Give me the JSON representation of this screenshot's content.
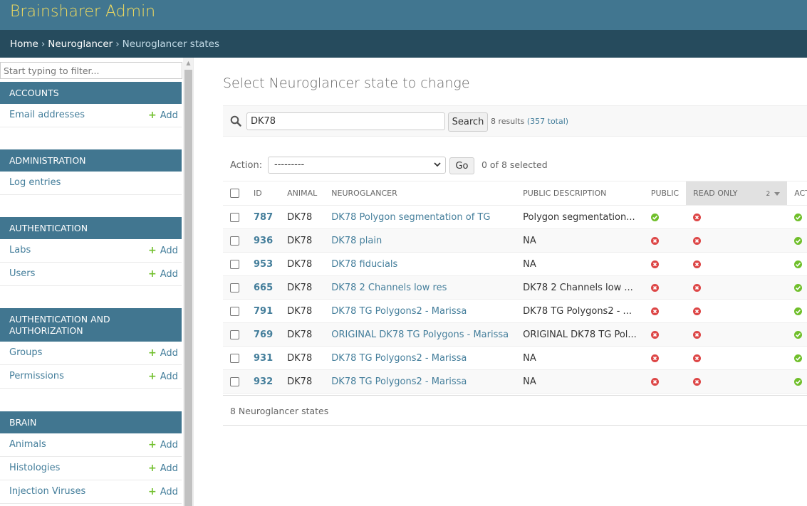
{
  "header": {
    "site_name": "Brainsharer Admin"
  },
  "breadcrumbs": {
    "home": "Home",
    "sep": "›",
    "app": "Neuroglancer",
    "current": "Neuroglancer states"
  },
  "sidebar": {
    "filter_placeholder": "Start typing to filter...",
    "add_label": "Add",
    "apps": [
      {
        "name": "ACCOUNTS",
        "models": [
          {
            "name": "Email addresses",
            "add": true
          }
        ]
      },
      {
        "name": "ADMINISTRATION",
        "models": [
          {
            "name": "Log entries",
            "add": false
          }
        ]
      },
      {
        "name": "AUTHENTICATION",
        "models": [
          {
            "name": "Labs",
            "add": true
          },
          {
            "name": "Users",
            "add": true
          }
        ]
      },
      {
        "name": "AUTHENTICATION AND AUTHORIZATION",
        "line1": "AUTHENTICATION AND",
        "line2": "AUTHORIZATION",
        "models": [
          {
            "name": "Groups",
            "add": true
          },
          {
            "name": "Permissions",
            "add": true
          }
        ]
      },
      {
        "name": "BRAIN",
        "models": [
          {
            "name": "Animals",
            "add": true
          },
          {
            "name": "Histologies",
            "add": true
          },
          {
            "name": "Injection Viruses",
            "add": true
          }
        ]
      }
    ]
  },
  "main": {
    "title": "Select Neuroglancer state to change",
    "search": {
      "value": "DK78",
      "button": "Search",
      "results": "8 results",
      "total": "(357 total)"
    },
    "actions": {
      "label": "Action:",
      "selected": "---------",
      "go": "Go",
      "counter": "0 of 8 selected"
    },
    "columns": {
      "id": "ID",
      "animal": "ANIMAL",
      "neuroglancer": "NEUROGLANCER",
      "description": "PUBLIC DESCRIPTION",
      "public": "PUBLIC",
      "readonly": "READ ONLY",
      "sort_priority": "2",
      "active": "ACTIVE"
    },
    "rows": [
      {
        "id": "787",
        "animal": "DK78",
        "neuroglancer": "DK78 Polygon segmentation of TG",
        "description": "Polygon segmentation...",
        "public": true,
        "readonly": false,
        "active": true
      },
      {
        "id": "936",
        "animal": "DK78",
        "neuroglancer": "DK78 plain",
        "description": "NA",
        "public": false,
        "readonly": false,
        "active": true
      },
      {
        "id": "953",
        "animal": "DK78",
        "neuroglancer": "DK78 fiducials",
        "description": "NA",
        "public": false,
        "readonly": false,
        "active": true
      },
      {
        "id": "665",
        "animal": "DK78",
        "neuroglancer": "DK78 2 Channels low res",
        "description": "DK78 2 Channels low ...",
        "public": false,
        "readonly": false,
        "active": true
      },
      {
        "id": "791",
        "animal": "DK78",
        "neuroglancer": "DK78 TG Polygons2 - Marissa",
        "description": "DK78 TG Polygons2 - ...",
        "public": false,
        "readonly": false,
        "active": true
      },
      {
        "id": "769",
        "animal": "DK78",
        "neuroglancer": "ORIGINAL DK78 TG Polygons - Marissa",
        "description": "ORIGINAL DK78 TG Pol...",
        "public": false,
        "readonly": false,
        "active": true
      },
      {
        "id": "931",
        "animal": "DK78",
        "neuroglancer": "DK78 TG Polygons2 - Marissa",
        "description": "NA",
        "public": false,
        "readonly": false,
        "active": true
      },
      {
        "id": "932",
        "animal": "DK78",
        "neuroglancer": "DK78 TG Polygons2 - Marissa",
        "description": "NA",
        "public": false,
        "readonly": false,
        "active": true
      }
    ],
    "paginator": "8 Neuroglancer states"
  },
  "colors": {
    "header_bg": "#417690",
    "branding": "#f5dd5d",
    "breadcrumbs_bg": "#264b5d",
    "link": "#447e9b",
    "add_green": "#70bf2b",
    "yes_green": "#70bf2b",
    "no_red": "#dd4646"
  },
  "icons": {
    "search": "search-icon",
    "yes": "icon-yes",
    "no": "icon-no",
    "add": "plus-icon"
  }
}
